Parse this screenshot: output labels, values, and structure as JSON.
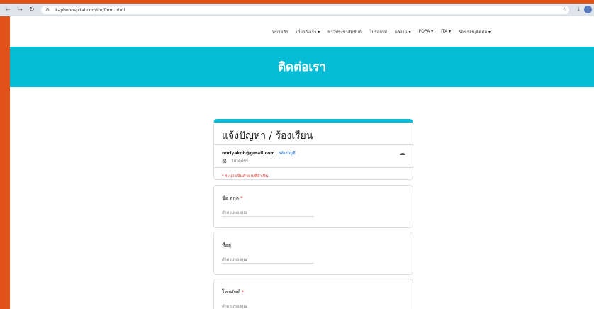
{
  "browser": {
    "url": "kaphohospital.com/im/form.html"
  },
  "nav": {
    "items": [
      {
        "label": "หน้าหลัก"
      },
      {
        "label": "เกี่ยวกับเรา ▾"
      },
      {
        "label": "ข่าวประชาสัมพันธ์"
      },
      {
        "label": "โปรแกรม"
      },
      {
        "label": "ผลงาน ▾"
      },
      {
        "label": "PDPA ▾"
      },
      {
        "label": "ITA ▾"
      },
      {
        "label": "ร้องเรียน/ติดต่อ ▾"
      }
    ]
  },
  "hero": {
    "title": "ติดต่อเรา"
  },
  "form": {
    "title": "แจ้งปัญหา / ร้องเรียน",
    "email": "noriyakoh@gmail.com",
    "switch_account": "สลับบัญชี",
    "not_shared": "ไม่ได้แชร์",
    "required_note": "* ระบุว่าเป็นคำถามที่จำเป็น",
    "questions": [
      {
        "label": "ชื่อ สกุล",
        "required": "*",
        "placeholder": "คำตอบของคุณ"
      },
      {
        "label": "ที่อยู่",
        "required": "",
        "placeholder": "คำตอบของคุณ"
      },
      {
        "label": "โทรศัพท์",
        "required": "*",
        "placeholder": "คำตอบของคุณ"
      }
    ]
  },
  "colors": {
    "accent": "#06bcd4",
    "background": "#e0521a",
    "required": "#d93025",
    "link": "#1a73e8"
  }
}
